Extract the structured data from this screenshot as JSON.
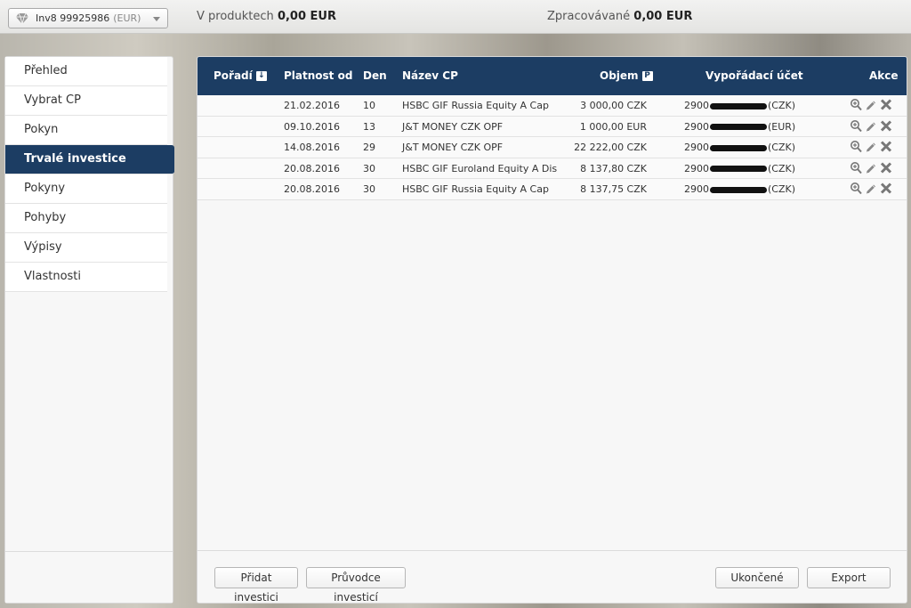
{
  "header": {
    "account_name": "Inv8 99925986",
    "account_currency": "(EUR)",
    "products_label": "V produktech",
    "products_value": "0,00 EUR",
    "processing_label": "Zpracovávané",
    "processing_value": "0,00 EUR"
  },
  "sidebar": {
    "items": [
      {
        "label": "Přehled"
      },
      {
        "label": "Vybrat CP"
      },
      {
        "label": "Pokyn"
      },
      {
        "label": "Trvalé investice"
      },
      {
        "label": "Pokyny"
      },
      {
        "label": "Pohyby"
      },
      {
        "label": "Výpisy"
      },
      {
        "label": "Vlastnosti"
      }
    ],
    "active_index": 3
  },
  "table": {
    "columns": {
      "order": "Pořadí",
      "order_sort_icon": "↓",
      "valid_from": "Platnost od",
      "day": "Den",
      "security": "Název CP",
      "volume": "Objem",
      "volume_badge": "P",
      "account": "Vypořádací účet",
      "actions": "Akce"
    },
    "rows": [
      {
        "valid_from": "21.02.2016",
        "day": "10",
        "security": "HSBC GIF Russia Equity A Cap",
        "volume": "3 000,00 CZK",
        "account_prefix": "2900",
        "account_currency": "(CZK)"
      },
      {
        "valid_from": "09.10.2016",
        "day": "13",
        "security": "J&T MONEY CZK OPF",
        "volume": "1 000,00 EUR",
        "account_prefix": "2900",
        "account_currency": "(EUR)"
      },
      {
        "valid_from": "14.08.2016",
        "day": "29",
        "security": "J&T MONEY CZK OPF",
        "volume": "22 222,00 CZK",
        "account_prefix": "2900",
        "account_currency": "(CZK)"
      },
      {
        "valid_from": "20.08.2016",
        "day": "30",
        "security": "HSBC GIF Euroland Equity A Dis",
        "volume": "8 137,80 CZK",
        "account_prefix": "2900",
        "account_currency": "(CZK)"
      },
      {
        "valid_from": "20.08.2016",
        "day": "30",
        "security": "HSBC GIF Russia Equity A Cap",
        "volume": "8 137,75 CZK",
        "account_prefix": "2900",
        "account_currency": "(CZK)"
      }
    ],
    "row_action_icons": [
      "magnifier-plus-icon",
      "pencil-icon",
      "delete-x-icon"
    ]
  },
  "footer": {
    "add_investment": "Přidat investici",
    "investment_wizard": "Průvodce investicí",
    "finished": "Ukončené",
    "export": "Export"
  },
  "colors": {
    "header_navy": "#1c3d63",
    "panel_bg": "#f7f7f7"
  }
}
